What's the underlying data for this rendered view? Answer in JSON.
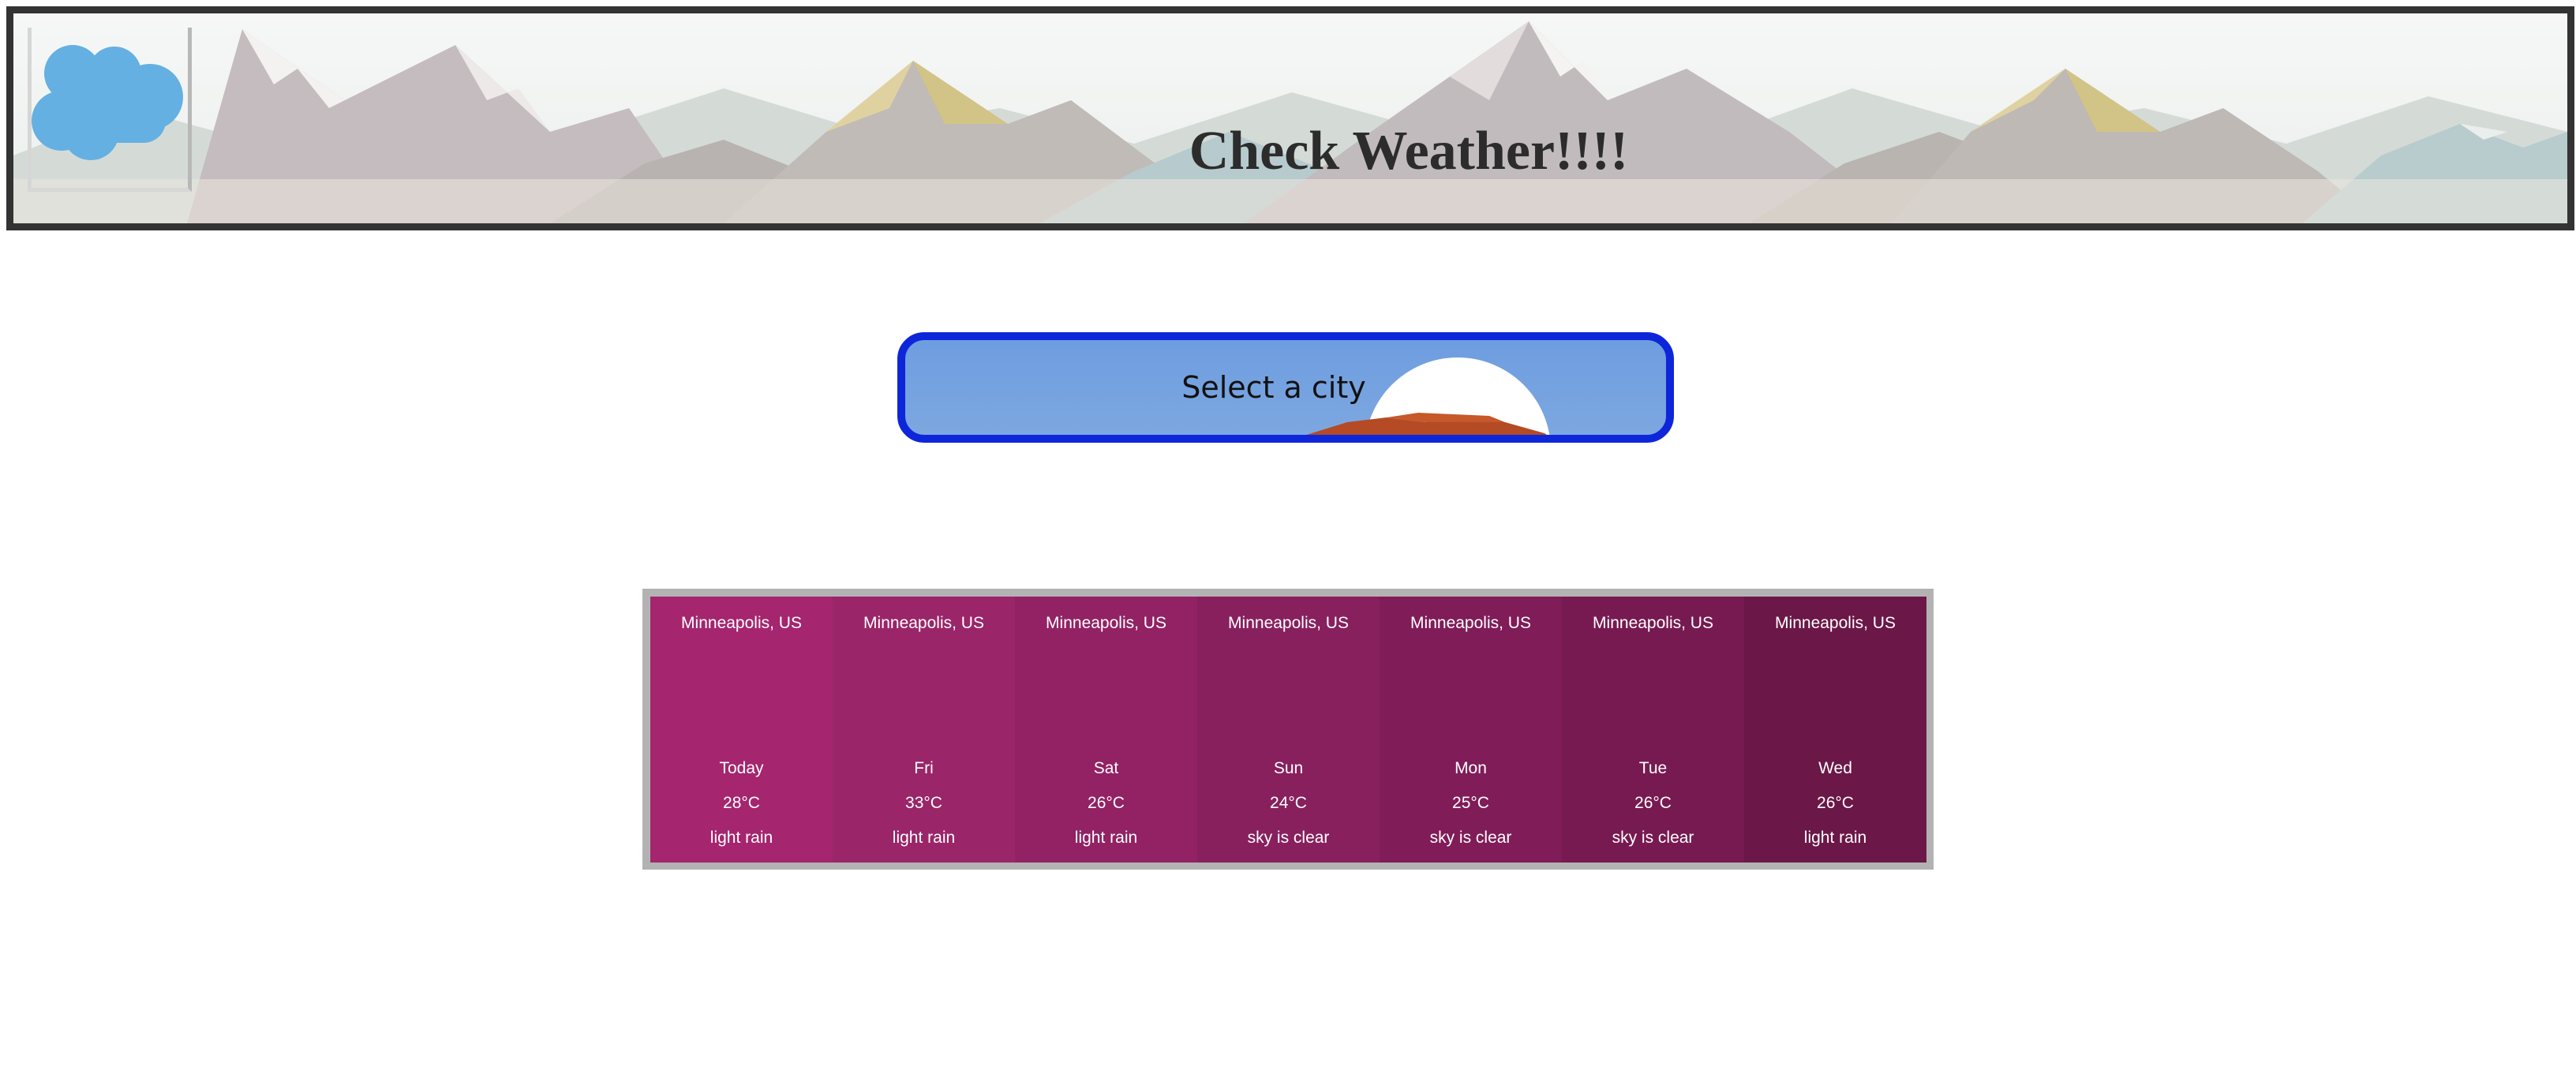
{
  "header": {
    "title": "Check Weather!!!!",
    "logo_icon": "cloud-icon"
  },
  "city_select": {
    "label": "Select a city",
    "icon": "sunset-icon"
  },
  "forecast": {
    "days": [
      {
        "city": "Minneapolis, US",
        "day": "Today",
        "temp": "28°C",
        "desc": "light rain",
        "color": "#a5256e"
      },
      {
        "city": "Minneapolis, US",
        "day": "Fri",
        "temp": "33°C",
        "desc": "light rain",
        "color": "#9b2569"
      },
      {
        "city": "Minneapolis, US",
        "day": "Sat",
        "temp": "26°C",
        "desc": "light rain",
        "color": "#922264"
      },
      {
        "city": "Minneapolis, US",
        "day": "Sun",
        "temp": "24°C",
        "desc": "sky is clear",
        "color": "#88205e"
      },
      {
        "city": "Minneapolis, US",
        "day": "Mon",
        "temp": "25°C",
        "desc": "sky is clear",
        "color": "#801c58"
      },
      {
        "city": "Minneapolis, US",
        "day": "Tue",
        "temp": "26°C",
        "desc": "sky is clear",
        "color": "#771a51"
      },
      {
        "city": "Minneapolis, US",
        "day": "Wed",
        "temp": "26°C",
        "desc": "light rain",
        "color": "#6b1748"
      }
    ]
  }
}
